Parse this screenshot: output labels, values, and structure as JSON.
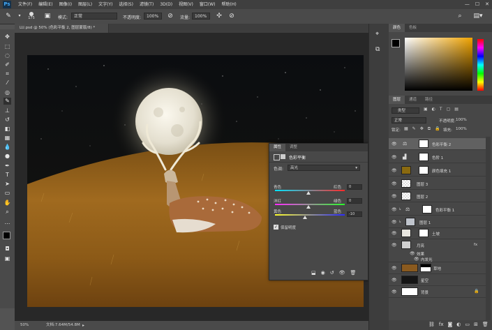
{
  "menubar": {
    "app_logo": "Ps",
    "items": [
      "文件(F)",
      "编辑(E)",
      "图像(I)",
      "图层(L)",
      "文字(Y)",
      "选择(S)",
      "滤镜(T)",
      "3D(D)",
      "视图(V)",
      "窗口(W)",
      "帮助(H)"
    ],
    "window_buttons": [
      "—",
      "☐",
      "✕"
    ]
  },
  "options": {
    "brush_size": "175",
    "mode_label": "模式:",
    "mode_value": "正常",
    "opacity_label": "不透明度:",
    "opacity_value": "100%",
    "flow_label": "流量:",
    "flow_value": "100%"
  },
  "document": {
    "tab_title": "LU.psd @ 50% (色彩平衡 2, 图层蒙版/8) *",
    "zoom": "50%",
    "doc_size": "文档:7.64M/54.8M"
  },
  "color_panel": {
    "tabs": [
      "颜色",
      "色板"
    ]
  },
  "layers_panel": {
    "tabs": [
      "图层",
      "通道",
      "路径"
    ],
    "filter_kind": "类型",
    "blend_mode": "正常",
    "opacity_label": "不透明度:",
    "opacity_value": "100%",
    "lock_label": "锁定:",
    "fill_label": "填充:",
    "fill_value": "100%",
    "layers": [
      {
        "name": "色彩平衡 2",
        "selected": true
      },
      {
        "name": "色阶 1",
        "selected": false
      },
      {
        "name": "颜色填充 1",
        "selected": false
      },
      {
        "name": "图层 3",
        "selected": false
      },
      {
        "name": "图层 2",
        "selected": false
      },
      {
        "name": "色彩平衡 1",
        "selected": false
      },
      {
        "name": "图层 1",
        "selected": false
      },
      {
        "name": "土坡",
        "selected": false
      },
      {
        "name": "月亮",
        "selected": false
      },
      {
        "name": "效果",
        "selected": false
      },
      {
        "name": "内发光",
        "selected": false
      },
      {
        "name": "草地",
        "selected": false
      },
      {
        "name": "星空",
        "selected": false
      },
      {
        "name": "背景",
        "selected": false
      }
    ],
    "fx_badge": "fx"
  },
  "properties": {
    "tabs": [
      "属性",
      "调整"
    ],
    "title": "色彩平衡",
    "tone_label": "色调:",
    "tone_value": "高光",
    "sliders": [
      {
        "left": "青色",
        "right": "红色",
        "value": "0"
      },
      {
        "left": "洋红",
        "right": "绿色",
        "value": "0"
      },
      {
        "left": "黄色",
        "right": "蓝色",
        "value": "-10"
      }
    ],
    "preserve_luminosity": "保留明度",
    "preserve_checked": true
  },
  "colors": {
    "accent": "#41a7f5",
    "panel_bg": "#474747",
    "selected_layer": "#616161"
  }
}
